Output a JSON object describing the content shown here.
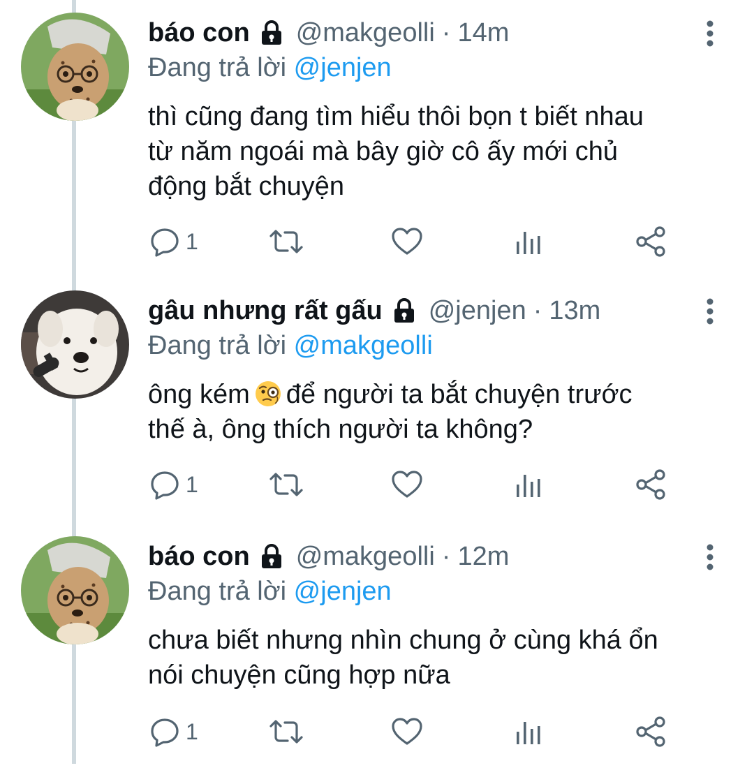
{
  "tweets": [
    {
      "name": "báo con",
      "handle": "@makgeolli",
      "separator": "·",
      "time": "14m",
      "reply_prefix": "Đang trả lời",
      "reply_handle": "@jenjen",
      "text": "thì cũng đang tìm hiểu thôi bọn t biết nhau\ntừ năm ngoái mà bây giờ cô ấy mới chủ\nđộng bắt chuyện",
      "reply_count": "1",
      "avatar": "cheetah-avatar"
    },
    {
      "name": "gâu nhưng rất gấu",
      "handle": "@jenjen",
      "separator": "·",
      "time": "13m",
      "reply_prefix": "Đang trả lời",
      "reply_handle": "@makgeolli",
      "text_before_emoji": "ông kém",
      "emoji": "face-with-monocle",
      "text_after_emoji": "để người ta bắt chuyện trước\nthế à, ông thích người ta không?",
      "reply_count": "1",
      "avatar": "white-dog-avatar"
    },
    {
      "name": "báo con",
      "handle": "@makgeolli",
      "separator": "·",
      "time": "12m",
      "reply_prefix": "Đang trả lời",
      "reply_handle": "@jenjen",
      "text": "chưa biết nhưng nhìn chung ở cùng khá ổn\nnói chuyện cũng hợp nữa",
      "reply_count": "1",
      "avatar": "cheetah-avatar"
    }
  ],
  "icons": {
    "lock": "lock-icon",
    "more": "more-vertical-icon",
    "reply": "reply-icon",
    "retweet": "retweet-icon",
    "like": "heart-icon",
    "views": "analytics-icon",
    "share": "share-icon"
  },
  "colors": {
    "text": "#0f1419",
    "secondary": "#536471",
    "link": "#1d9bf0",
    "thread_line": "#cfd9de"
  }
}
